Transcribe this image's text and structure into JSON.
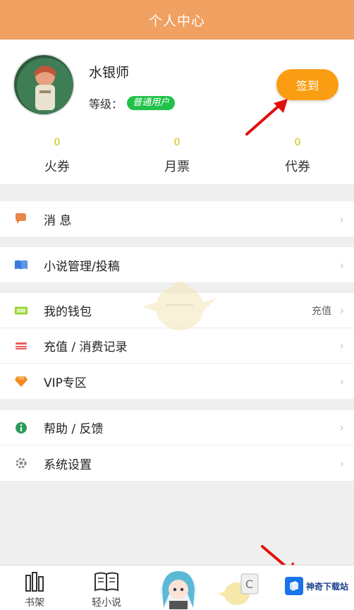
{
  "header": {
    "title": "个人中心"
  },
  "profile": {
    "username": "水银师",
    "level_label": "等级：",
    "level_badge": "普通用户",
    "signin_label": "签到"
  },
  "stats": [
    {
      "value": "0",
      "label": "火券"
    },
    {
      "value": "0",
      "label": "月票"
    },
    {
      "value": "0",
      "label": "代券"
    }
  ],
  "menu": {
    "messages": {
      "label": "消 息",
      "icon": "chat-bubble-icon"
    },
    "novel_manage": {
      "label": "小说管理/投稿",
      "icon": "book-icon"
    },
    "wallet": {
      "label": "我的钱包",
      "right": "充值",
      "icon": "wallet-icon"
    },
    "records": {
      "label": "充值 / 消费记录",
      "icon": "flag-card-icon"
    },
    "vip": {
      "label": "VIP专区",
      "icon": "diamond-icon"
    },
    "help": {
      "label": "帮助 / 反馈",
      "icon": "info-icon"
    },
    "settings": {
      "label": "系统设置",
      "icon": "gear-icon"
    }
  },
  "tabbar": {
    "bookshelf": "书架",
    "light_novel": "轻小说"
  },
  "watermark": {
    "text": "神奇下载站"
  },
  "colors": {
    "header": "#f0a060",
    "signin": "#fb9d12",
    "badge": "#22c24a",
    "stat_number": "#d4c000"
  }
}
